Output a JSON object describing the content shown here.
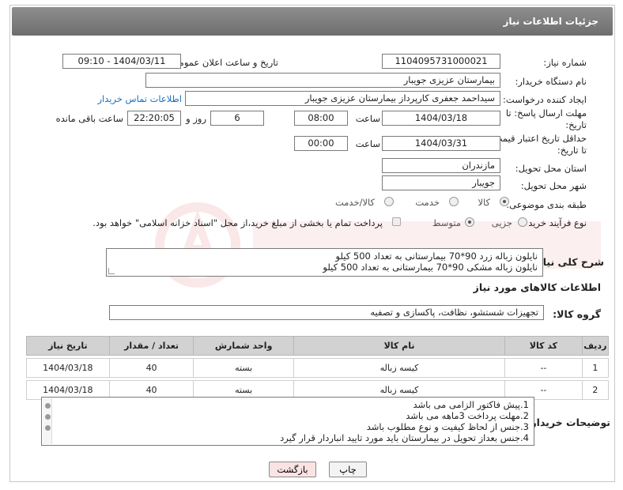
{
  "header": {
    "title": "جزئیات اطلاعات نیاز"
  },
  "form": {
    "need_number": {
      "label": "شماره نیاز:",
      "value": "1104095731000021"
    },
    "announce_datetime": {
      "label": "تاریخ و ساعت اعلان عمومی:",
      "value": "1404/03/11 - 09:10"
    },
    "buyer_org": {
      "label": "نام دستگاه خریدار:",
      "value": "بیمارستان عزیزی جویبار"
    },
    "requester": {
      "label": "ایجاد کننده درخواست:",
      "value": "سیداحمد جعفری کارپرداز بیمارستان عزیزی جویبار",
      "contact_link": "اطلاعات تماس خریدار"
    },
    "reply_deadline": {
      "label_line1": "مهلت ارسال پاسخ: تا",
      "label_line2": "تاریخ:",
      "date": "1404/03/18",
      "time_label": "ساعت",
      "time": "08:00",
      "days": "6",
      "days_label": "روز و",
      "remaining": "22:20:05",
      "remaining_label": "ساعت باقی مانده"
    },
    "price_validity": {
      "label_line1": "حداقل تاریخ اعتبار قیمت:",
      "label_line2": "تا تاریخ:",
      "date": "1404/03/31",
      "time_label": "ساعت",
      "time": "00:00"
    },
    "province": {
      "label": "استان محل تحویل:",
      "value": "مازندران"
    },
    "city": {
      "label": "شهر محل تحویل:",
      "value": "جویبار"
    },
    "category": {
      "label": "طبقه بندی موضوعی:",
      "options": [
        "کالا",
        "خدمت",
        "کالا/خدمت"
      ],
      "selected": "کالا"
    },
    "process_type": {
      "label": "نوع فرآیند خرید :",
      "options": [
        "جزیی",
        "متوسط"
      ],
      "selected": "متوسط",
      "treasury_note": "پرداخت تمام یا بخشی از مبلغ خرید،از محل \"اسناد خزانه اسلامی\" خواهد بود."
    },
    "description": {
      "label": "شرح کلی نیاز:",
      "lines": [
        "نایلون زباله زرد 90*70 بیمارستانی به تعداد  500 کیلو",
        "نایلون زباله مشکی 90*70 بیمارستانی به تعداد 500 کیلو"
      ]
    }
  },
  "goods_section": {
    "title": "اطلاعات کالاهای مورد نیاز",
    "group_label": "گروه کالا:",
    "group_value": "تجهیزات شستشو، نظافت، پاکسازی و تصفیه"
  },
  "table": {
    "headers": [
      "ردیف",
      "کد کالا",
      "نام کالا",
      "واحد شمارش",
      "تعداد / مقدار",
      "تاریخ نیاز"
    ],
    "rows": [
      [
        "1",
        "--",
        "کیسه زباله",
        "بسته",
        "40",
        "1404/03/18"
      ],
      [
        "2",
        "--",
        "کیسه زباله",
        "بسته",
        "40",
        "1404/03/18"
      ]
    ]
  },
  "buyer_notes": {
    "label": "توضیحات خریدار:",
    "lines": [
      "1.پیش فاکتور الزامی می باشد",
      "2.مهلت پرداخت 3ماهه می باشد",
      "3.جنس از لحاظ کیفیت و نوع مطلوب باشد",
      "4.جنس بعداز تحویل در بیمارستان باید مورد تایید انباردار قرار گیرد"
    ]
  },
  "buttons": {
    "print": "چاپ",
    "back": "بازگشت"
  },
  "colors": {
    "header_bg": "#7e7e7e",
    "link": "#1a6fc4",
    "back_button_bg": "#fbe3e3",
    "table_header_bg": "#d2d2d2"
  }
}
